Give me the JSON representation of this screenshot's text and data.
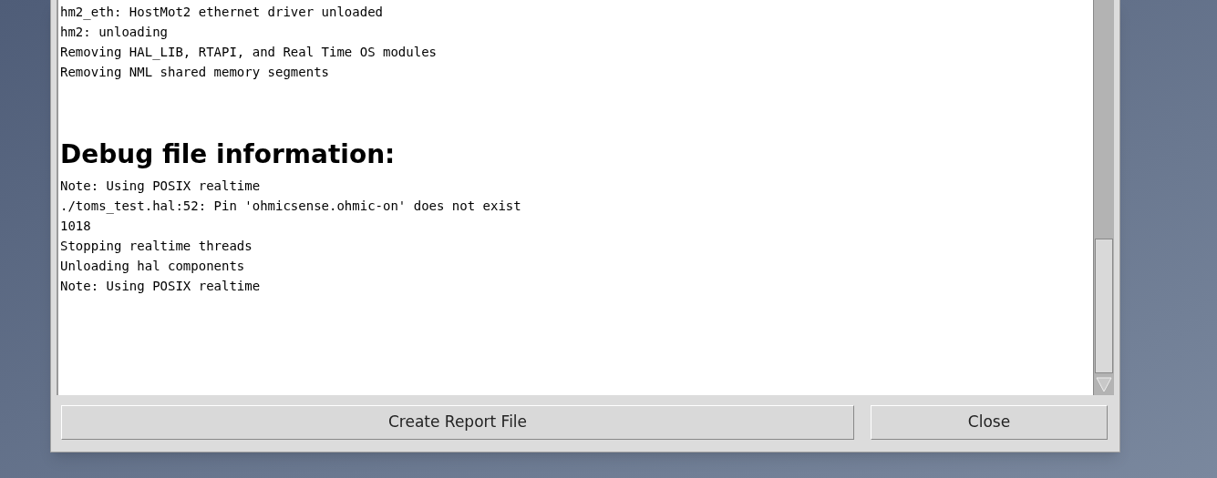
{
  "log": {
    "lines": [
      "hm2_eth: HostMot2 ethernet driver unloaded",
      "hm2: unloading",
      "Removing HAL_LIB, RTAPI, and Real Time OS modules",
      "Removing NML shared memory segments"
    ],
    "debug_heading": "Debug file information:",
    "debug_lines": [
      "Note: Using POSIX realtime",
      "./toms_test.hal:52: Pin 'ohmicsense.ohmic-on' does not exist",
      "1018",
      "Stopping realtime threads",
      "Unloading hal components",
      "Note: Using POSIX realtime"
    ]
  },
  "buttons": [
    {
      "kind": "report",
      "label": "Create Report File"
    },
    {
      "kind": "close",
      "label": "Close"
    }
  ]
}
